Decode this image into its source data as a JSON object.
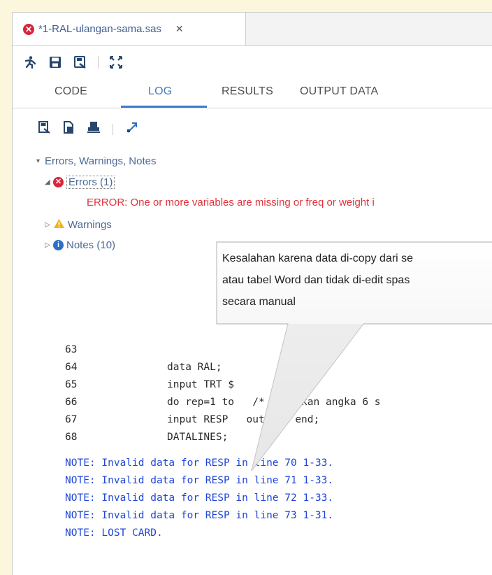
{
  "file_tab": {
    "title": "*1-RAL-ulangan-sama.sas",
    "close_label": "✕"
  },
  "toolbar": {
    "icons": [
      "run-icon",
      "save-icon",
      "save-as-icon",
      "maximize-icon"
    ]
  },
  "subtabs": [
    {
      "label": "CODE"
    },
    {
      "label": "LOG"
    },
    {
      "label": "RESULTS"
    },
    {
      "label": "OUTPUT DATA"
    }
  ],
  "log_toolbar": {
    "icons": [
      "save-log-icon",
      "export-log-icon",
      "print-icon",
      "expand-icon"
    ]
  },
  "tree": {
    "root_label": "Errors, Warnings, Notes",
    "errors_label": "Errors (1)",
    "error_message": "ERROR: One or more variables are missing or freq or weight i",
    "warnings_label": "Warnings",
    "notes_label": "Notes (10)"
  },
  "callout": {
    "lines": [
      "Kesalahan karena data di-copy dari se",
      "atau tabel Word dan tidak di-edit spas",
      "secara manual"
    ]
  },
  "code_lines": [
    {
      "num": "63",
      "text": ""
    },
    {
      "num": "64",
      "text": "data RAL;"
    },
    {
      "num": "65",
      "text": "input TRT $"
    },
    {
      "num": "66",
      "text": "do rep=1 to   /* Gantikan angka 6 s"
    },
    {
      "num": "67",
      "text": "input RESP   output; end;"
    },
    {
      "num": "68",
      "text": "DATALINES;"
    }
  ],
  "notes": [
    "NOTE: Invalid data for RESP in line 70 1-33.",
    "NOTE: Invalid data for RESP in line 71 1-33.",
    "NOTE: Invalid data for RESP in line 72 1-33.",
    "NOTE: Invalid data for RESP in line 73 1-31.",
    "NOTE: LOST CARD."
  ]
}
